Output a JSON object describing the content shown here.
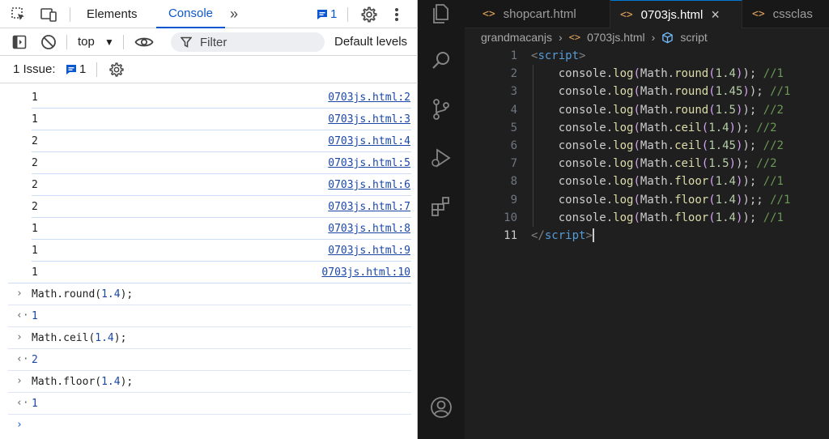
{
  "devtools": {
    "tabs": [
      "Elements",
      "Console"
    ],
    "active_tab": "Console",
    "more_tabs": "»",
    "messages_badge_count": "1",
    "toolbar": {
      "context": "top",
      "filter_placeholder": "Filter",
      "levels": "Default levels"
    },
    "issues": {
      "label": "1 Issue:",
      "count": "1"
    },
    "logs": [
      {
        "value": "1",
        "source": "0703js.html:2"
      },
      {
        "value": "1",
        "source": "0703js.html:3"
      },
      {
        "value": "2",
        "source": "0703js.html:4"
      },
      {
        "value": "2",
        "source": "0703js.html:5"
      },
      {
        "value": "2",
        "source": "0703js.html:6"
      },
      {
        "value": "2",
        "source": "0703js.html:7"
      },
      {
        "value": "1",
        "source": "0703js.html:8"
      },
      {
        "value": "1",
        "source": "0703js.html:9"
      },
      {
        "value": "1",
        "source": "0703js.html:10"
      }
    ],
    "evaluations": [
      {
        "input_fn": "Math.round(",
        "input_arg": "1.4",
        "input_end": ");",
        "result": "1"
      },
      {
        "input_fn": "Math.ceil(",
        "input_arg": "1.4",
        "input_end": ");",
        "result": "2"
      },
      {
        "input_fn": "Math.floor(",
        "input_arg": "1.4",
        "input_end": ");",
        "result": "1"
      }
    ]
  },
  "editor": {
    "tabs": [
      {
        "label": "shopcart.html",
        "active": false
      },
      {
        "label": "0703js.html",
        "active": true,
        "close": "×"
      },
      {
        "label": "cssclas",
        "active": false
      }
    ],
    "breadcrumb": {
      "folder": "grandmacanjs",
      "file": "0703js.html",
      "symbol": "script"
    },
    "lines": [
      {
        "n": "1",
        "open_tag": "<",
        "tag": "script",
        "close_tag": ">"
      },
      {
        "n": "2",
        "fn": "round",
        "arg": "1.4",
        "end": ");",
        "comment": "//1"
      },
      {
        "n": "3",
        "fn": "round",
        "arg": "1.45",
        "end": ");",
        "comment": "//1"
      },
      {
        "n": "4",
        "fn": "round",
        "arg": "1.5",
        "end": ");",
        "comment": "//2"
      },
      {
        "n": "5",
        "fn": "ceil",
        "arg": "1.4",
        "end": ");",
        "comment": "//2"
      },
      {
        "n": "6",
        "fn": "ceil",
        "arg": "1.45",
        "end": ");",
        "comment": "//2"
      },
      {
        "n": "7",
        "fn": "ceil",
        "arg": "1.5",
        "end": ");",
        "comment": "//2"
      },
      {
        "n": "8",
        "fn": "floor",
        "arg": "1.4",
        "end": ");",
        "comment": "//1"
      },
      {
        "n": "9",
        "fn": "floor",
        "arg": "1.4",
        "end": ");;",
        "comment": "//1"
      },
      {
        "n": "10",
        "fn": "floor",
        "arg": "1.4",
        "end": ");",
        "comment": "//1"
      },
      {
        "n": "11",
        "open_tag": "</",
        "tag": "script",
        "close_tag": ">"
      }
    ]
  },
  "colors": {
    "devtools_accent": "#0b57d0",
    "link": "#1a47a6",
    "editor_bg": "#1f1f1f",
    "activity_bg": "#181818"
  }
}
